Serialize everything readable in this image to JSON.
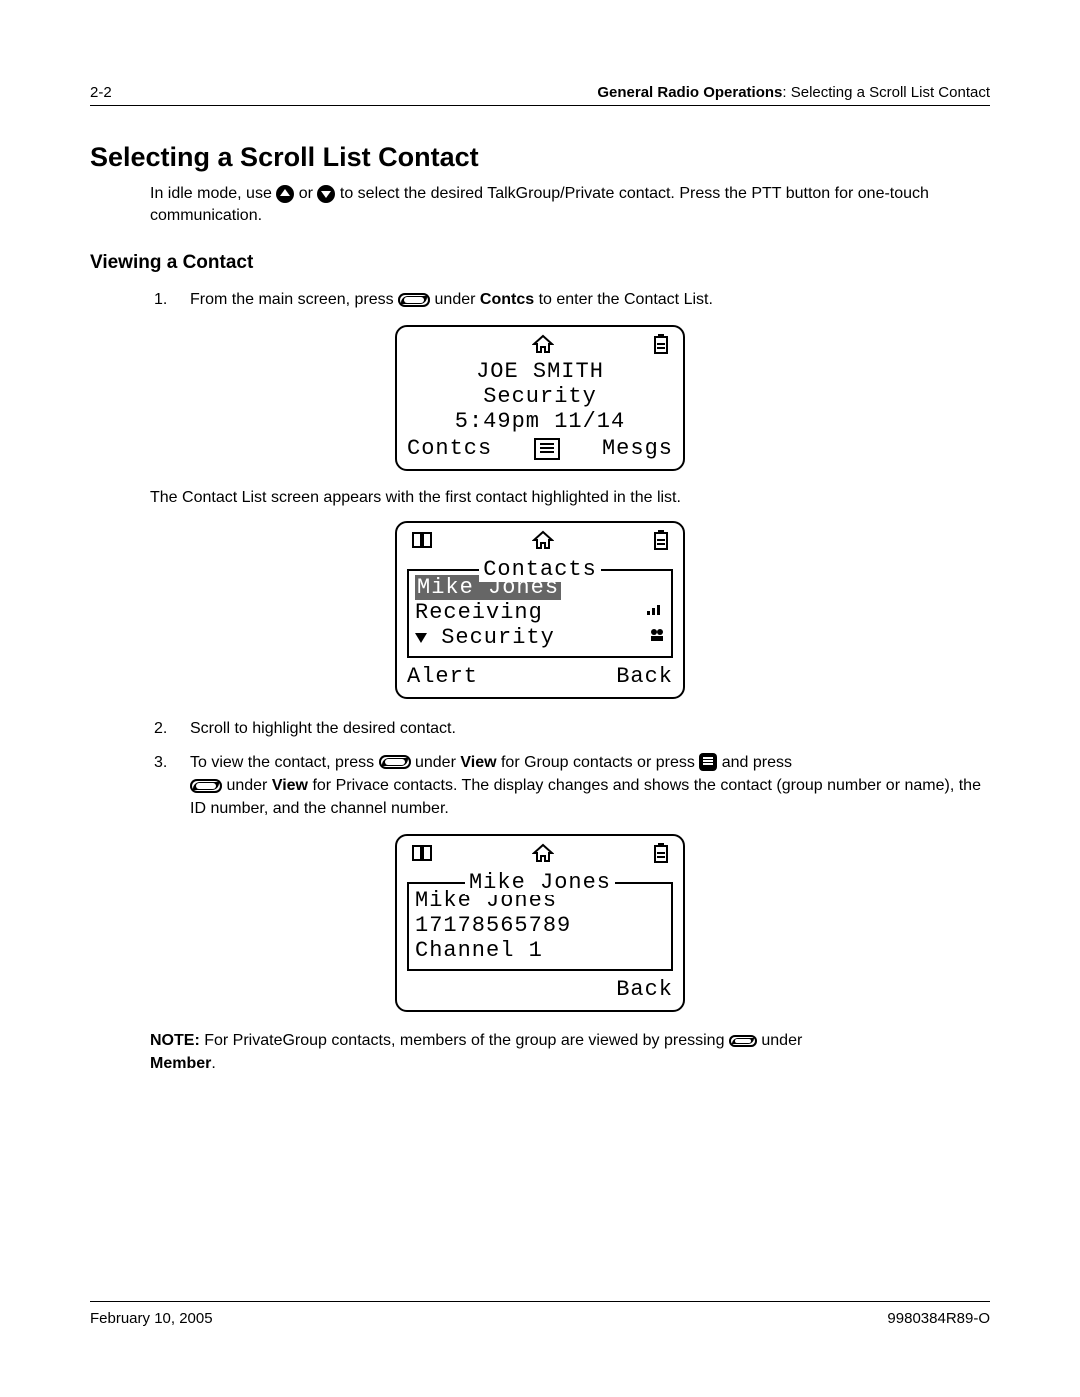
{
  "header": {
    "pageNum": "2-2",
    "chapter": "General Radio Operations",
    "section": "Selecting a Scroll List Contact"
  },
  "title": "Selecting a Scroll List Contact",
  "intro": {
    "line1a": "In idle mode, use ",
    "or": " or ",
    "line1b": " to select the desired TalkGroup/Private contact. Press the PTT button for one-touch communication."
  },
  "sub1": "Viewing a Contact",
  "steps": {
    "s1a": "From the main screen, press ",
    "s1b": " under ",
    "s1bold": "Contcs",
    "s1c": " to enter the Contact List.",
    "s2": "Scroll to highlight the desired contact.",
    "s3a": "To view the contact, press ",
    "s3b": " under ",
    "s3bold1": "View",
    "s3c": " for Group contacts or press ",
    "s3d": " and press ",
    "s3e": " under ",
    "s3bold2": "View",
    "s3f": " for Privace contacts. The display changes and shows the contact (group number or name), the ID number, and the channel number."
  },
  "para1": "The Contact List screen appears with the first contact highlighted in the list.",
  "note": {
    "label": "NOTE:",
    "a": " For PrivateGroup contacts, members of the group are viewed by pressing ",
    "b": " under ",
    "bold": "Member",
    "c": "."
  },
  "screen1": {
    "name": "JOE SMITH",
    "dept": "Security",
    "time": "5:49pm  11/14",
    "left": "Contcs",
    "right": "Mesgs"
  },
  "screen2": {
    "title": "Contacts",
    "sel": "Mike Jones",
    "line2": "Receiving",
    "line3": "Security",
    "left": "Alert",
    "right": "Back"
  },
  "screen3": {
    "title": "Mike Jones",
    "line1": "Mike Jones",
    "line2": "17178565789",
    "line3": "Channel 1",
    "right": "Back"
  },
  "footer": {
    "date": "February 10, 2005",
    "doc": "9980384R89-O"
  }
}
